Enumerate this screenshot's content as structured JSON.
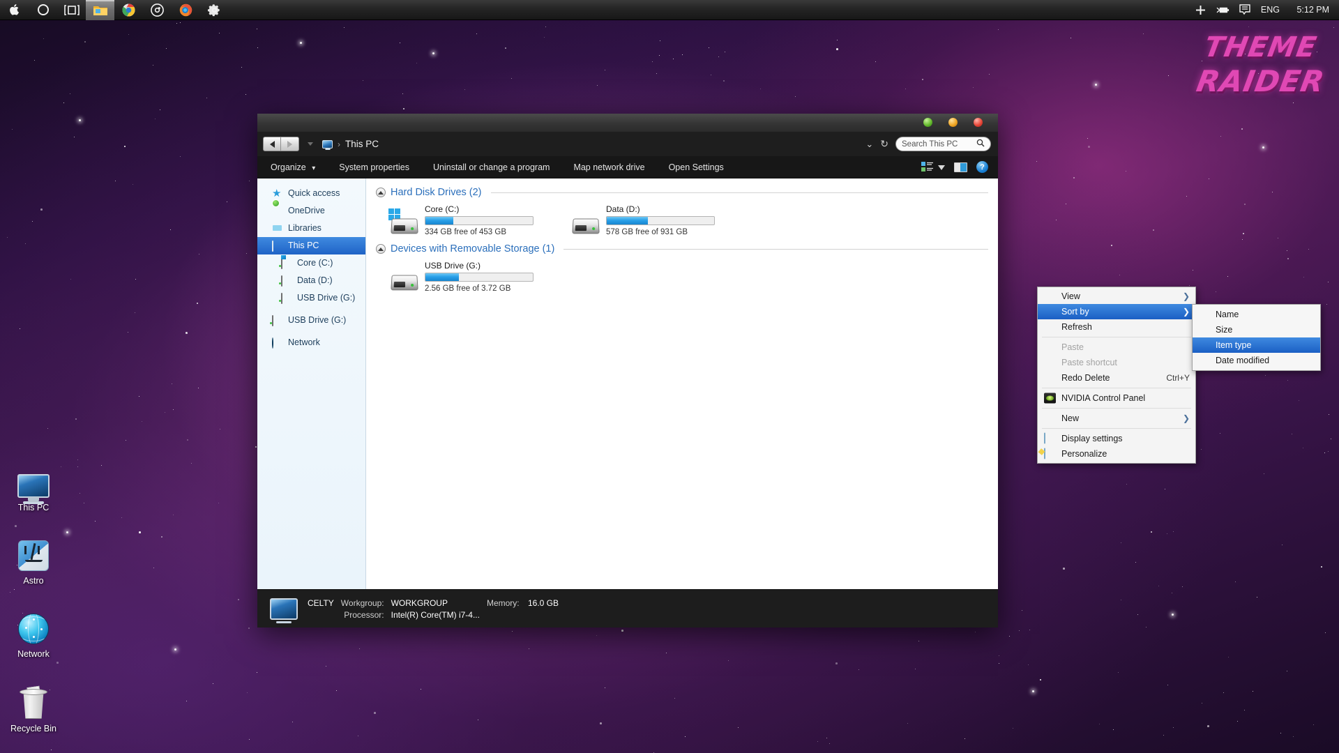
{
  "taskbar": {
    "left_items": [
      {
        "name": "apple-menu",
        "icon": "apple-icon",
        "label": ""
      },
      {
        "name": "circle-button",
        "icon": "circle-icon",
        "label": ""
      },
      {
        "name": "task-view",
        "icon": "taskview-icon",
        "label": ""
      },
      {
        "name": "file-explorer",
        "icon": "folder-icon",
        "label": ""
      },
      {
        "name": "chrome",
        "icon": "chrome-icon",
        "label": ""
      },
      {
        "name": "media-player",
        "icon": "disc-icon",
        "label": ""
      },
      {
        "name": "firefox",
        "icon": "firefox-icon",
        "label": ""
      },
      {
        "name": "settings",
        "icon": "gear-icon",
        "label": ""
      }
    ],
    "tray": {
      "add_label": "+",
      "battery_icon": "battery-icon",
      "notifications_icon": "speech-bubble-icon",
      "language": "ENG",
      "clock": "5:12 PM"
    }
  },
  "watermark": {
    "line1": "THEME",
    "line2": "RAIDER"
  },
  "desktop_icons": [
    {
      "label": "This PC",
      "icon": "monitor-icon"
    },
    {
      "label": "Astro",
      "icon": "finder-face-icon"
    },
    {
      "label": "Network",
      "icon": "globe-icon"
    },
    {
      "label": "Recycle Bin",
      "icon": "recycle-bin-icon"
    }
  ],
  "explorer": {
    "titlebar": {
      "close_label": "",
      "minimize_label": "",
      "maximize_label": ""
    },
    "address": {
      "back_label": "",
      "forward_label": "",
      "dropdown_label": "",
      "breadcrumb_icon": "this-pc-icon",
      "breadcrumb_sep": "›",
      "breadcrumb_text": "This PC",
      "chevron": "⌄",
      "refresh": "↻"
    },
    "search": {
      "placeholder": "Search This PC",
      "value": "Search This PC",
      "icon": "magnifier-icon"
    },
    "commandbar": {
      "items": [
        {
          "label": "Organize",
          "has_caret": true
        },
        {
          "label": "System properties",
          "has_caret": false
        },
        {
          "label": "Uninstall or change a program",
          "has_caret": false
        },
        {
          "label": "Map network drive",
          "has_caret": false
        },
        {
          "label": "Open Settings",
          "has_caret": false
        }
      ],
      "caret": "▾",
      "right_icons": [
        {
          "name": "view-options-icon"
        },
        {
          "name": "view-dropdown-caret"
        },
        {
          "name": "preview-pane-icon"
        },
        {
          "name": "help-icon",
          "label": "?"
        }
      ]
    },
    "navpane": {
      "items": [
        {
          "label": "Quick access",
          "icon": "star-icon",
          "indent": false,
          "selected": false
        },
        {
          "label": "OneDrive",
          "icon": "cloud-icon",
          "indent": false,
          "selected": false
        },
        {
          "label": "Libraries",
          "icon": "library-folder-icon",
          "indent": false,
          "selected": false
        },
        {
          "label": "This PC",
          "icon": "this-pc-icon",
          "indent": false,
          "selected": true
        },
        {
          "label": "Core (C:)",
          "icon": "windows-drive-icon",
          "indent": true,
          "selected": false
        },
        {
          "label": "Data (D:)",
          "icon": "drive-icon",
          "indent": true,
          "selected": false
        },
        {
          "label": "USB Drive (G:)",
          "icon": "drive-icon",
          "indent": true,
          "selected": false
        },
        {
          "label": "USB Drive (G:)",
          "icon": "drive-icon",
          "indent": false,
          "selected": false
        },
        {
          "label": "Network",
          "icon": "globe-icon",
          "indent": false,
          "selected": false
        }
      ]
    },
    "groups": [
      {
        "title": "Hard Disk Drives (2)",
        "drives": [
          {
            "name": "Core (C:)",
            "free_text": "334 GB free of 453 GB",
            "used_percent": 26,
            "icon": "windows-hdd-icon"
          },
          {
            "name": "Data (D:)",
            "free_text": "578 GB free of 931 GB",
            "used_percent": 38,
            "icon": "hdd-icon"
          }
        ]
      },
      {
        "title": "Devices with Removable Storage (1)",
        "drives": [
          {
            "name": "USB Drive (G:)",
            "free_text": "2.56 GB free of 3.72 GB",
            "used_percent": 31,
            "icon": "hdd-icon"
          }
        ]
      }
    ],
    "statusbar": {
      "computer_name": "CELTY",
      "workgroup_key": "Workgroup:",
      "workgroup_value": "WORKGROUP",
      "memory_key": "Memory:",
      "memory_value": "16.0 GB",
      "processor_key": "Processor:",
      "processor_value": "Intel(R) Core(TM) i7-4..."
    }
  },
  "context_menu": {
    "items": [
      {
        "label": "View",
        "type": "submenu",
        "selected": false,
        "disabled": false,
        "icon": null,
        "accel": null
      },
      {
        "label": "Sort by",
        "type": "submenu",
        "selected": true,
        "disabled": false,
        "icon": null,
        "accel": null
      },
      {
        "label": "Refresh",
        "type": "item",
        "selected": false,
        "disabled": false,
        "icon": null,
        "accel": null
      },
      {
        "type": "separator"
      },
      {
        "label": "Paste",
        "type": "item",
        "selected": false,
        "disabled": true,
        "icon": null,
        "accel": null
      },
      {
        "label": "Paste shortcut",
        "type": "item",
        "selected": false,
        "disabled": true,
        "icon": null,
        "accel": null
      },
      {
        "label": "Redo Delete",
        "type": "item",
        "selected": false,
        "disabled": false,
        "icon": null,
        "accel": "Ctrl+Y"
      },
      {
        "type": "separator"
      },
      {
        "label": "NVIDIA Control Panel",
        "type": "item",
        "selected": false,
        "disabled": false,
        "icon": "nvidia-icon",
        "accel": null
      },
      {
        "type": "separator"
      },
      {
        "label": "New",
        "type": "submenu",
        "selected": false,
        "disabled": false,
        "icon": null,
        "accel": null
      },
      {
        "type": "separator"
      },
      {
        "label": "Display settings",
        "type": "item",
        "selected": false,
        "disabled": false,
        "icon": "display-icon",
        "accel": null
      },
      {
        "label": "Personalize",
        "type": "item",
        "selected": false,
        "disabled": false,
        "icon": "personalize-icon",
        "accel": null
      }
    ],
    "submenu_arrow": "❯"
  },
  "submenu": {
    "items": [
      {
        "label": "Name",
        "selected": false
      },
      {
        "label": "Size",
        "selected": false
      },
      {
        "label": "Item type",
        "selected": true
      },
      {
        "label": "Date modified",
        "selected": false
      }
    ]
  }
}
